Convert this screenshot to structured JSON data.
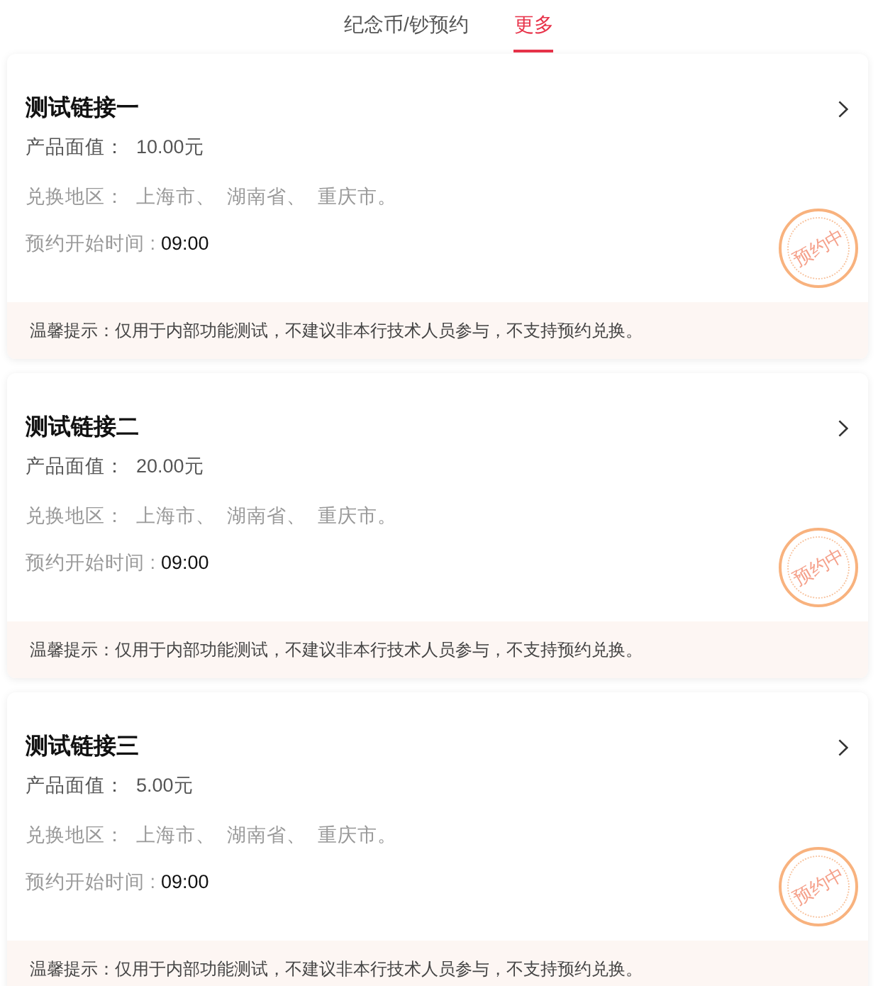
{
  "tabs": [
    {
      "label": "纪念币/钞预约",
      "selected": false
    },
    {
      "label": "更多",
      "selected": true
    }
  ],
  "cards": [
    {
      "title": "测试链接一",
      "value_label": "产品面值：",
      "value": "10.00元",
      "region_label": "兑换地区：",
      "regions": [
        "上海市、",
        "湖南省、",
        "重庆市。"
      ],
      "time_label": "预约开始时间 :",
      "time": "09:00",
      "stamp": "预约中",
      "tip": "温馨提示：仅用于内部功能测试，不建议非本行技术人员参与，不支持预约兑换。"
    },
    {
      "title": "测试链接二",
      "value_label": "产品面值：",
      "value": "20.00元",
      "region_label": "兑换地区：",
      "regions": [
        "上海市、",
        "湖南省、",
        "重庆市。"
      ],
      "time_label": "预约开始时间 :",
      "time": "09:00",
      "stamp": "预约中",
      "tip": "温馨提示：仅用于内部功能测试，不建议非本行技术人员参与，不支持预约兑换。"
    },
    {
      "title": "测试链接三",
      "value_label": "产品面值：",
      "value": "5.00元",
      "region_label": "兑换地区：",
      "regions": [
        "上海市、",
        "湖南省、",
        "重庆市。"
      ],
      "time_label": "预约开始时间 :",
      "time": "09:00",
      "stamp": "预约中",
      "tip": "温馨提示：仅用于内部功能测试，不建议非本行技术人员参与，不支持预约兑换。"
    }
  ]
}
